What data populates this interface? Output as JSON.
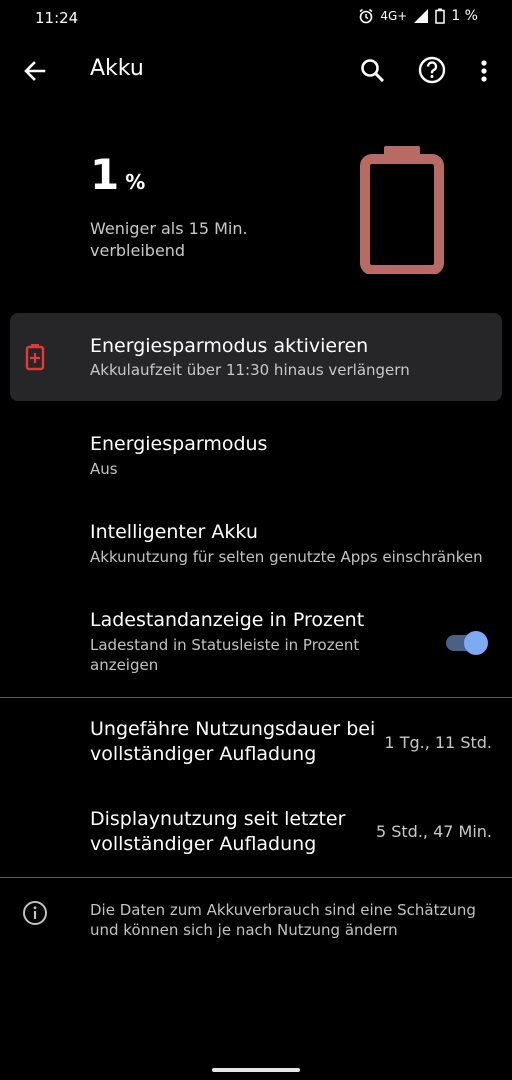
{
  "status": {
    "time": "11:24",
    "network": "4G+",
    "battery_percent": "1 %"
  },
  "toolbar": {
    "title": "Akku",
    "icons": [
      "back-arrow-icon",
      "search-icon",
      "help-icon",
      "more-vert-icon"
    ]
  },
  "hero": {
    "percent": "1",
    "unit": "%",
    "remaining": "Weniger als 15 Min. verbleibend",
    "battery_color": "#b86b64"
  },
  "suggestion": {
    "title": "Energiesparmodus aktivieren",
    "subtitle": "Akkulaufzeit über 11:30 hinaus verlängern",
    "icon_color": "#e53935"
  },
  "settings": {
    "saver": {
      "title": "Energiesparmodus",
      "subtitle": "Aus"
    },
    "adaptive": {
      "title": "Intelligenter Akku",
      "subtitle": "Akkunutzung für selten genutzte Apps einschränken"
    },
    "percentage": {
      "title": "Ladestandanzeige in Prozent",
      "subtitle": "Ladestand in Statusleiste in Prozent anzeigen",
      "enabled": true
    }
  },
  "usage": {
    "full_charge": {
      "title": "Ungefähre Nutzungsdauer bei vollständiger Aufladung",
      "value": "1 Tg., 11 Std."
    },
    "screen": {
      "title": "Displaynutzung seit letzter vollständiger Aufladung",
      "value": "5 Std., 47 Min."
    }
  },
  "footer": {
    "info": "Die Daten zum Akkuverbrauch sind eine Schätzung und können sich je nach Nutzung ändern"
  },
  "colors": {
    "accent": "#7eaaf3",
    "card_bg": "#262628"
  }
}
